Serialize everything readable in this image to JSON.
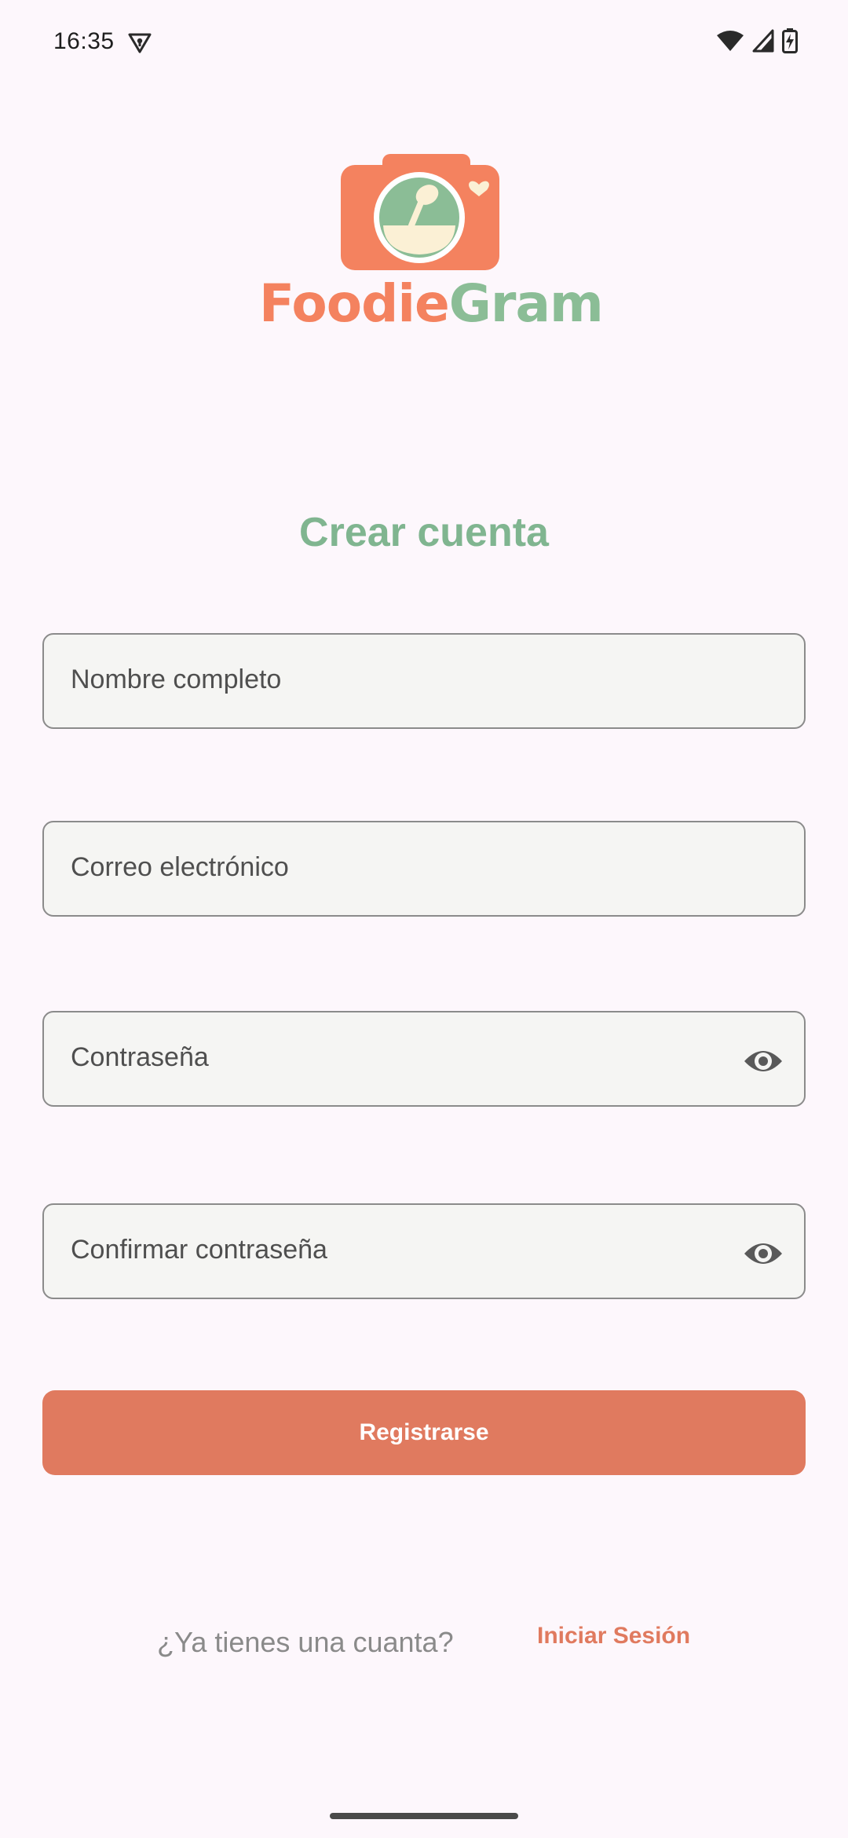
{
  "status_bar": {
    "time": "16:35"
  },
  "logo": {
    "text_part1": "Foodie",
    "text_part2": "Gram"
  },
  "title": "Crear cuenta",
  "fields": {
    "name_label": "Nombre completo",
    "email_label": "Correo electrónico",
    "password_label": "Contraseña",
    "confirm_password_label": "Confirmar contraseña"
  },
  "register_button": "Registrarse",
  "footer": {
    "question": "¿Ya tienes una cuanta?",
    "login_link": "Iniciar Sesión"
  },
  "colors": {
    "background": "#fdf7fc",
    "accent_orange": "#e07a5f",
    "accent_green": "#80b590",
    "logo_orange": "#f4825f",
    "logo_green": "#8bbd96"
  },
  "icons": {
    "status_vpn": "vpn-key-icon",
    "status_wifi": "wifi-icon",
    "status_signal": "cell-signal-icon",
    "status_battery": "battery-charging-icon",
    "password_eye": "eye-icon",
    "logo_camera": "camera-bowl-icon"
  }
}
